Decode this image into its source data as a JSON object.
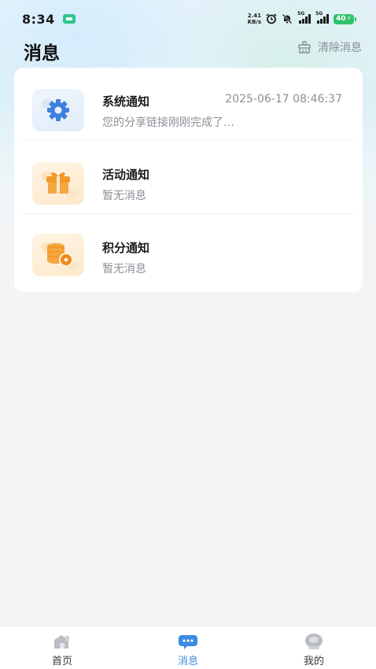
{
  "status_bar": {
    "time": "8:34",
    "net_speed_value": "2.41",
    "net_speed_unit": "KB/s",
    "signal_1_label": "5G",
    "signal_2_label": "5G",
    "battery": "40"
  },
  "header": {
    "title": "消息",
    "clear_label": "清除消息"
  },
  "messages": [
    {
      "title": "系统通知",
      "time": "2025-06-17 08:46:37",
      "preview": "您的分享链接刚刚完成了…",
      "icon": "gear-icon",
      "accent": "#3d7fe0"
    },
    {
      "title": "活动通知",
      "time": "",
      "preview": "暂无消息",
      "icon": "gift-icon",
      "accent": "#f39a2b"
    },
    {
      "title": "积分通知",
      "time": "",
      "preview": "暂无消息",
      "icon": "coins-icon",
      "accent": "#f39a2b"
    }
  ],
  "bottom_nav": {
    "items": [
      {
        "label": "首页",
        "icon": "home-icon",
        "active": false
      },
      {
        "label": "消息",
        "icon": "chat-bubble-icon",
        "active": true
      },
      {
        "label": "我的",
        "icon": "profile-icon",
        "active": false
      }
    ],
    "active_color": "#3a8be0",
    "inactive_color": "#b9bcc2"
  }
}
